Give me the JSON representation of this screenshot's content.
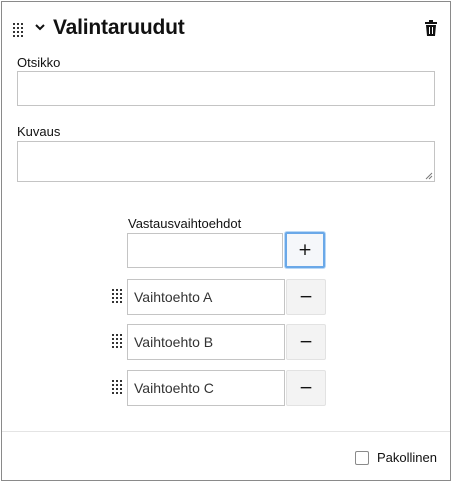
{
  "header": {
    "title": "Valintaruudut",
    "drag_icon": "drag-handle-icon",
    "collapse_icon": "chevron-down-icon",
    "delete_icon": "trash-icon"
  },
  "fields": {
    "title_label": "Otsikko",
    "title_value": "",
    "description_label": "Kuvaus",
    "description_value": ""
  },
  "options": {
    "label": "Vastausvaihtoehdot",
    "new_option_value": "",
    "add_label": "+",
    "remove_label": "−",
    "items": [
      {
        "value": "Vaihtoehto A"
      },
      {
        "value": "Vaihtoehto B"
      },
      {
        "value": "Vaihtoehto C"
      }
    ]
  },
  "footer": {
    "required_label": "Pakollinen",
    "required_checked": false
  },
  "colors": {
    "border": "#8a8a8a",
    "focus": "#6aa8e8",
    "button_bg": "#f3f3f3"
  }
}
